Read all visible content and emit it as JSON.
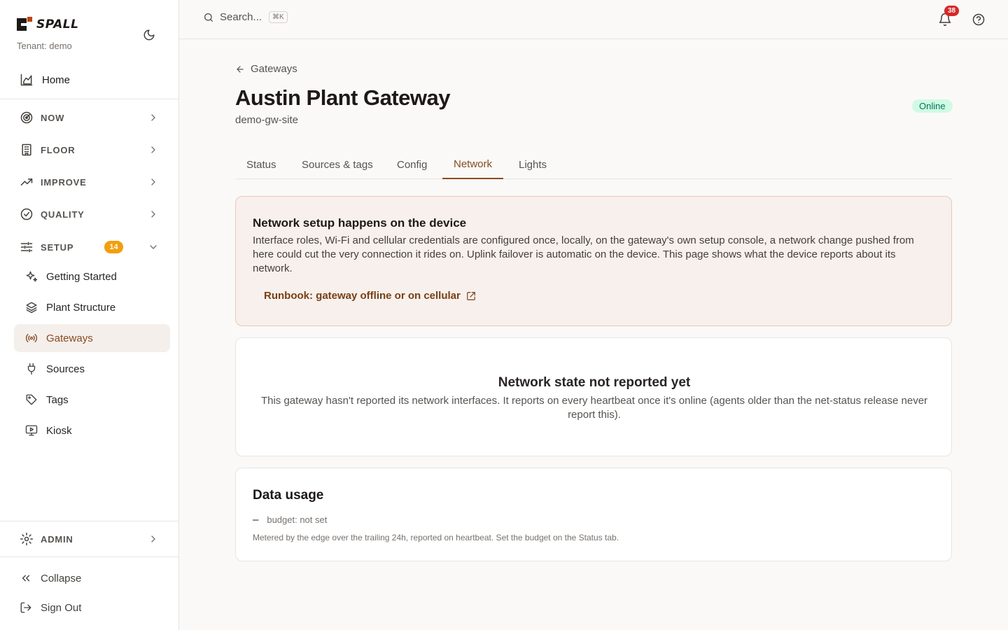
{
  "brand": {
    "name": "SPALL",
    "tenant": "Tenant: demo"
  },
  "sidebar": {
    "home": "Home",
    "groups": [
      {
        "label": "NOW",
        "icon": "radar-icon"
      },
      {
        "label": "FLOOR",
        "icon": "building-icon"
      },
      {
        "label": "IMPROVE",
        "icon": "trending-up-icon"
      },
      {
        "label": "QUALITY",
        "icon": "check-circle-icon"
      },
      {
        "label": "SETUP",
        "icon": "sliders-icon",
        "badge": "14",
        "expanded": true
      }
    ],
    "setup_items": [
      {
        "label": "Getting Started",
        "icon": "sparkles-icon"
      },
      {
        "label": "Plant Structure",
        "icon": "layers-icon"
      },
      {
        "label": "Gateways",
        "icon": "radio-icon",
        "active": true
      },
      {
        "label": "Sources",
        "icon": "plug-icon"
      },
      {
        "label": "Tags",
        "icon": "tag-icon"
      },
      {
        "label": "Kiosk",
        "icon": "monitor-play-icon"
      }
    ],
    "admin": "ADMIN",
    "collapse": "Collapse",
    "sign_out": "Sign Out"
  },
  "topbar": {
    "search_placeholder": "Search...",
    "shortcut": "⌘K",
    "notifications": "38"
  },
  "page": {
    "back_label": "Gateways",
    "title": "Austin Plant Gateway",
    "subtitle": "demo-gw-site",
    "status": "Online"
  },
  "tabs": [
    "Status",
    "Sources & tags",
    "Config",
    "Network",
    "Lights"
  ],
  "active_tab": "Network",
  "notice": {
    "title": "Network setup happens on the device",
    "text": "Interface roles, Wi-Fi and cellular credentials are configured once, locally, on the gateway's own setup console, a network change pushed from here could cut the very connection it rides on. Uplink failover is automatic on the device. This page shows what the device reports about its network.",
    "link": "Runbook: gateway offline or on cellular"
  },
  "network_state": {
    "title": "Network state not reported yet",
    "text": "This gateway hasn't reported its network interfaces. It reports on every heartbeat once it's online (agents older than the net-status release never report this)."
  },
  "data_usage": {
    "title": "Data usage",
    "value": "–",
    "budget": "budget: not set",
    "note": "Metered by the edge over the trailing 24h, reported on heartbeat. Set the budget on the Status tab."
  },
  "colors": {
    "accent": "#8a4b1f",
    "online": "#047857",
    "badge": "#f59e0b",
    "notif": "#dc2626"
  }
}
